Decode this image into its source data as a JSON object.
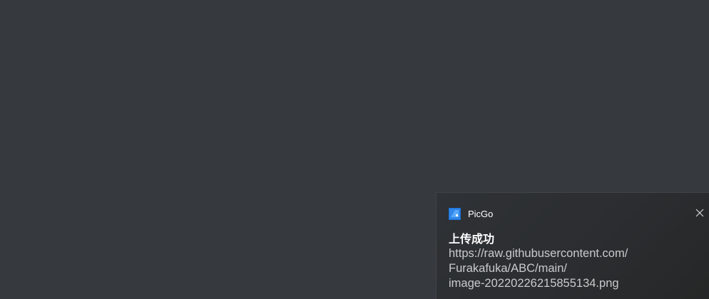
{
  "notification": {
    "app_name": "PicGo",
    "app_icon": "picgo-app-icon",
    "close_icon": "close-icon",
    "title": "上传成功",
    "message_lines": [
      "https://raw.githubusercontent.com/",
      "Furakafuka/ABC/main/",
      "image-20220226215855134.png"
    ]
  },
  "colors": {
    "desktop_background": "#363a3f",
    "toast_background": "#2b2d30",
    "title_text": "#ffffff",
    "message_text": "#c9cacb",
    "app_icon_blue": "#1a6fd6"
  }
}
